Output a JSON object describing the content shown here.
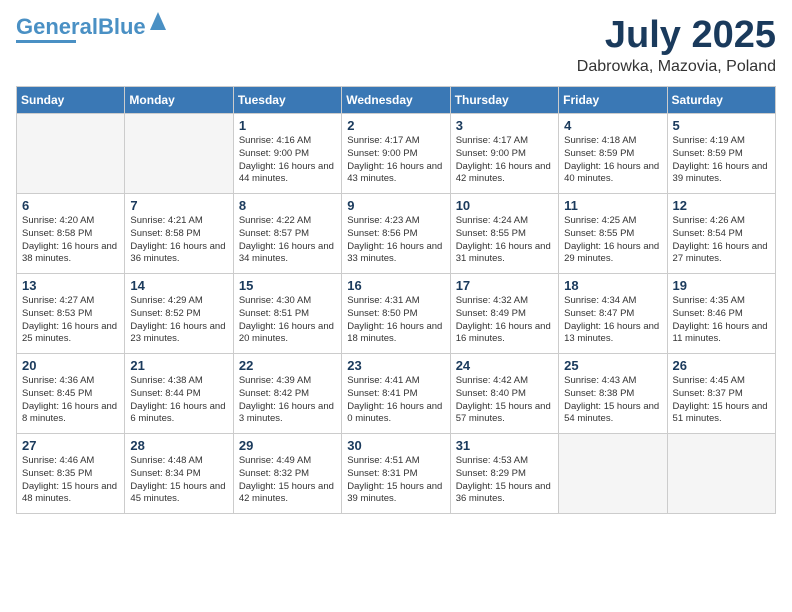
{
  "logo": {
    "part1": "General",
    "part2": "Blue"
  },
  "title": "July 2025",
  "location": "Dabrowka, Mazovia, Poland",
  "weekdays": [
    "Sunday",
    "Monday",
    "Tuesday",
    "Wednesday",
    "Thursday",
    "Friday",
    "Saturday"
  ],
  "weeks": [
    [
      {
        "day": "",
        "empty": true
      },
      {
        "day": "",
        "empty": true
      },
      {
        "day": "1",
        "sunrise": "4:16 AM",
        "sunset": "9:00 PM",
        "daylight": "16 hours and 44 minutes."
      },
      {
        "day": "2",
        "sunrise": "4:17 AM",
        "sunset": "9:00 PM",
        "daylight": "16 hours and 43 minutes."
      },
      {
        "day": "3",
        "sunrise": "4:17 AM",
        "sunset": "9:00 PM",
        "daylight": "16 hours and 42 minutes."
      },
      {
        "day": "4",
        "sunrise": "4:18 AM",
        "sunset": "8:59 PM",
        "daylight": "16 hours and 40 minutes."
      },
      {
        "day": "5",
        "sunrise": "4:19 AM",
        "sunset": "8:59 PM",
        "daylight": "16 hours and 39 minutes."
      }
    ],
    [
      {
        "day": "6",
        "sunrise": "4:20 AM",
        "sunset": "8:58 PM",
        "daylight": "16 hours and 38 minutes."
      },
      {
        "day": "7",
        "sunrise": "4:21 AM",
        "sunset": "8:58 PM",
        "daylight": "16 hours and 36 minutes."
      },
      {
        "day": "8",
        "sunrise": "4:22 AM",
        "sunset": "8:57 PM",
        "daylight": "16 hours and 34 minutes."
      },
      {
        "day": "9",
        "sunrise": "4:23 AM",
        "sunset": "8:56 PM",
        "daylight": "16 hours and 33 minutes."
      },
      {
        "day": "10",
        "sunrise": "4:24 AM",
        "sunset": "8:55 PM",
        "daylight": "16 hours and 31 minutes."
      },
      {
        "day": "11",
        "sunrise": "4:25 AM",
        "sunset": "8:55 PM",
        "daylight": "16 hours and 29 minutes."
      },
      {
        "day": "12",
        "sunrise": "4:26 AM",
        "sunset": "8:54 PM",
        "daylight": "16 hours and 27 minutes."
      }
    ],
    [
      {
        "day": "13",
        "sunrise": "4:27 AM",
        "sunset": "8:53 PM",
        "daylight": "16 hours and 25 minutes."
      },
      {
        "day": "14",
        "sunrise": "4:29 AM",
        "sunset": "8:52 PM",
        "daylight": "16 hours and 23 minutes."
      },
      {
        "day": "15",
        "sunrise": "4:30 AM",
        "sunset": "8:51 PM",
        "daylight": "16 hours and 20 minutes."
      },
      {
        "day": "16",
        "sunrise": "4:31 AM",
        "sunset": "8:50 PM",
        "daylight": "16 hours and 18 minutes."
      },
      {
        "day": "17",
        "sunrise": "4:32 AM",
        "sunset": "8:49 PM",
        "daylight": "16 hours and 16 minutes."
      },
      {
        "day": "18",
        "sunrise": "4:34 AM",
        "sunset": "8:47 PM",
        "daylight": "16 hours and 13 minutes."
      },
      {
        "day": "19",
        "sunrise": "4:35 AM",
        "sunset": "8:46 PM",
        "daylight": "16 hours and 11 minutes."
      }
    ],
    [
      {
        "day": "20",
        "sunrise": "4:36 AM",
        "sunset": "8:45 PM",
        "daylight": "16 hours and 8 minutes."
      },
      {
        "day": "21",
        "sunrise": "4:38 AM",
        "sunset": "8:44 PM",
        "daylight": "16 hours and 6 minutes."
      },
      {
        "day": "22",
        "sunrise": "4:39 AM",
        "sunset": "8:42 PM",
        "daylight": "16 hours and 3 minutes."
      },
      {
        "day": "23",
        "sunrise": "4:41 AM",
        "sunset": "8:41 PM",
        "daylight": "16 hours and 0 minutes."
      },
      {
        "day": "24",
        "sunrise": "4:42 AM",
        "sunset": "8:40 PM",
        "daylight": "15 hours and 57 minutes."
      },
      {
        "day": "25",
        "sunrise": "4:43 AM",
        "sunset": "8:38 PM",
        "daylight": "15 hours and 54 minutes."
      },
      {
        "day": "26",
        "sunrise": "4:45 AM",
        "sunset": "8:37 PM",
        "daylight": "15 hours and 51 minutes."
      }
    ],
    [
      {
        "day": "27",
        "sunrise": "4:46 AM",
        "sunset": "8:35 PM",
        "daylight": "15 hours and 48 minutes."
      },
      {
        "day": "28",
        "sunrise": "4:48 AM",
        "sunset": "8:34 PM",
        "daylight": "15 hours and 45 minutes."
      },
      {
        "day": "29",
        "sunrise": "4:49 AM",
        "sunset": "8:32 PM",
        "daylight": "15 hours and 42 minutes."
      },
      {
        "day": "30",
        "sunrise": "4:51 AM",
        "sunset": "8:31 PM",
        "daylight": "15 hours and 39 minutes."
      },
      {
        "day": "31",
        "sunrise": "4:53 AM",
        "sunset": "8:29 PM",
        "daylight": "15 hours and 36 minutes."
      },
      {
        "day": "",
        "empty": true
      },
      {
        "day": "",
        "empty": true
      }
    ]
  ]
}
